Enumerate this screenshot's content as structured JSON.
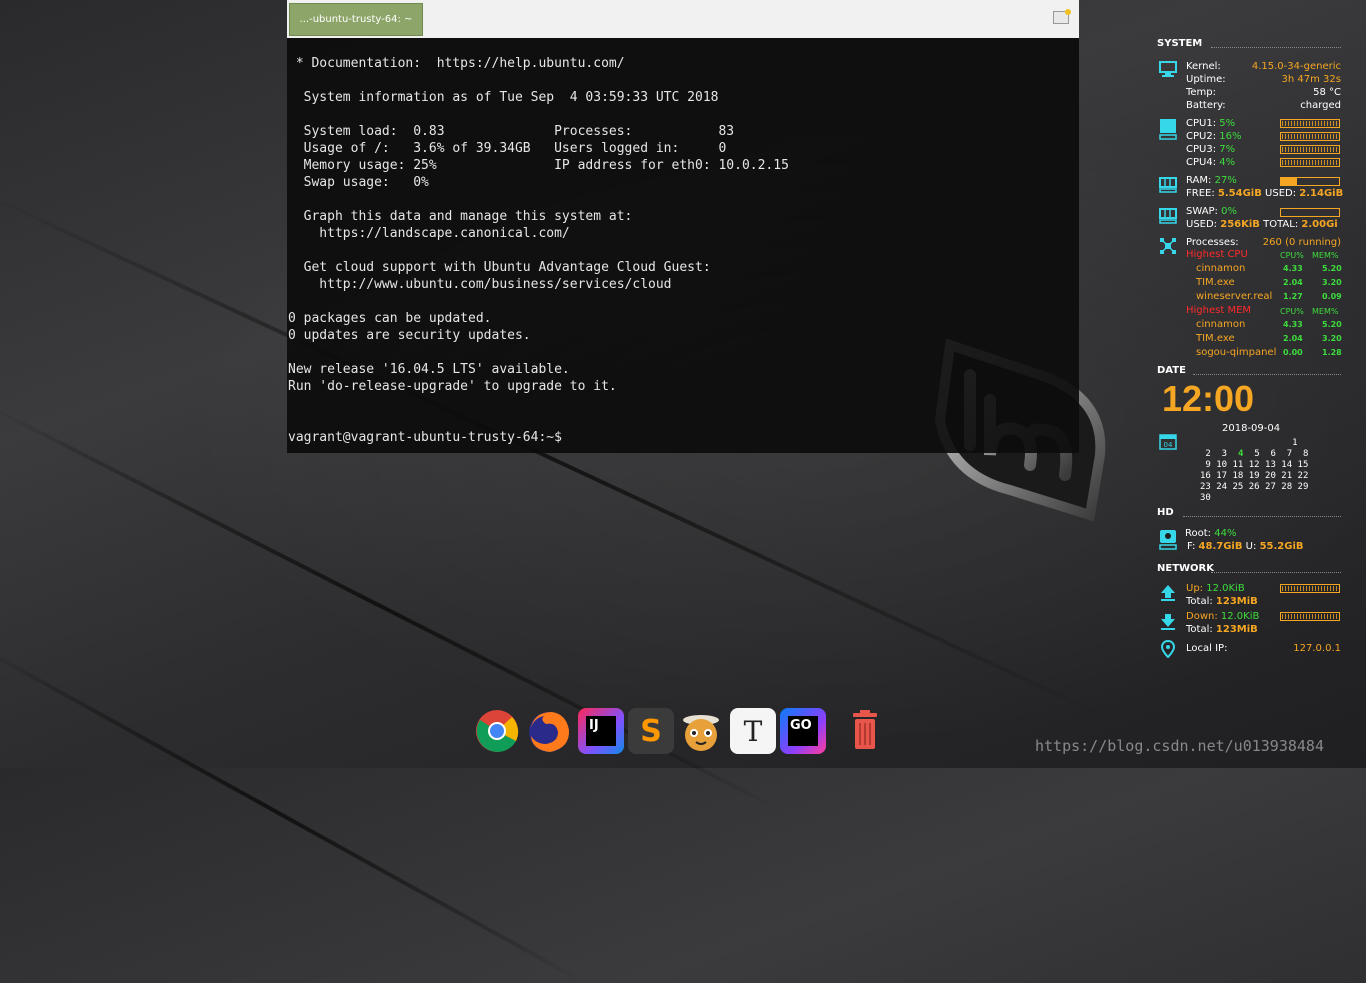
{
  "terminal": {
    "tab_title": "...-ubuntu-trusty-64: ~",
    "lines": [
      " * Documentation:  https://help.ubuntu.com/",
      "",
      "  System information as of Tue Sep  4 03:59:33 UTC 2018",
      "",
      "  System load:  0.83              Processes:           83",
      "  Usage of /:   3.6% of 39.34GB   Users logged in:     0",
      "  Memory usage: 25%               IP address for eth0: 10.0.2.15",
      "  Swap usage:   0%",
      "",
      "  Graph this data and manage this system at:",
      "    https://landscape.canonical.com/",
      "",
      "  Get cloud support with Ubuntu Advantage Cloud Guest:",
      "    http://www.ubuntu.com/business/services/cloud",
      "",
      "0 packages can be updated.",
      "0 updates are security updates.",
      "",
      "New release '16.04.5 LTS' available.",
      "Run 'do-release-upgrade' to upgrade to it.",
      "",
      "",
      "vagrant@vagrant-ubuntu-trusty-64:~$"
    ]
  },
  "conky": {
    "system": {
      "header": "SYSTEM",
      "kernel_label": "Kernel:",
      "kernel": "4.15.0-34-generic",
      "uptime_label": "Uptime:",
      "uptime": "3h 47m 32s",
      "temp_label": "Temp:",
      "temp": "58 °C",
      "battery_label": "Battery:",
      "battery": "charged"
    },
    "cpus": [
      {
        "label": "CPU1:",
        "value": "5%"
      },
      {
        "label": "CPU2:",
        "value": "16%"
      },
      {
        "label": "CPU3:",
        "value": "7%"
      },
      {
        "label": "CPU4:",
        "value": "4%"
      }
    ],
    "ram": {
      "label": "RAM:",
      "value": "27%",
      "percent": 27,
      "free_label": "FREE:",
      "free": "5.54GiB",
      "used_label": "USED:",
      "used": "2.14GiB"
    },
    "swap": {
      "label": "SWAP:",
      "value": "0%",
      "percent": 0,
      "used_label": "USED:",
      "used": "256KiB",
      "total_label": "TOTAL:",
      "total": "2.00Gi"
    },
    "processes": {
      "label": "Processes:",
      "value": "260 (0 running)",
      "highest_cpu": "Highest CPU",
      "highest_mem": "Highest MEM",
      "cpu_col": "CPU%",
      "mem_col": "MEM%",
      "top_cpu": [
        {
          "name": "cinnamon",
          "cpu": "4.33",
          "mem": "5.20"
        },
        {
          "name": "TIM.exe",
          "cpu": "2.04",
          "mem": "3.20"
        },
        {
          "name": "wineserver.real",
          "cpu": "1.27",
          "mem": "0.09"
        }
      ],
      "top_mem": [
        {
          "name": "cinnamon",
          "cpu": "4.33",
          "mem": "5.20"
        },
        {
          "name": "TIM.exe",
          "cpu": "2.04",
          "mem": "3.20"
        },
        {
          "name": "sogou-qimpanel",
          "cpu": "0.00",
          "mem": "1.28"
        }
      ]
    },
    "date": {
      "header": "DATE",
      "time": "12:00",
      "date": "2018-09-04",
      "cal_icon_day": "04",
      "calendar": [
        "                 1",
        " 2  3  4  5  6  7  8",
        " 9 10 11 12 13 14 15",
        "16 17 18 19 20 21 22",
        "23 24 25 26 27 28 29",
        "30"
      ]
    },
    "hd": {
      "header": "HD",
      "root_label": "Root:",
      "root": "44%",
      "free_label": "F:",
      "free": "48.7GiB",
      "used_label": "U:",
      "used": "55.2GiB"
    },
    "network": {
      "header": "NETWORK",
      "up_label": "Up:",
      "up": "12.0KiB",
      "up_total_label": "Total:",
      "up_total": "123MiB",
      "down_label": "Down:",
      "down": "12.0KiB",
      "down_total_label": "Total:",
      "down_total": "123MiB",
      "ip_label": "Local IP:",
      "ip": "127.0.0.1"
    }
  },
  "dock": {
    "items": [
      {
        "name": "chrome",
        "glyph": ""
      },
      {
        "name": "firefox",
        "glyph": ""
      },
      {
        "name": "intellij",
        "glyph": "IJ"
      },
      {
        "name": "sublime",
        "glyph": "S"
      },
      {
        "name": "cat-app",
        "glyph": ""
      },
      {
        "name": "typora",
        "glyph": "T"
      },
      {
        "name": "goland",
        "glyph": "GO"
      },
      {
        "name": "trash",
        "glyph": ""
      }
    ]
  },
  "watermark": "https://blog.csdn.net/u013938484",
  "colors": {
    "accent": "#f5a623",
    "ok": "#3ddc3d",
    "alert": "#ff2a2a",
    "icon": "#35d7e8",
    "tab": "#8ea56a"
  }
}
